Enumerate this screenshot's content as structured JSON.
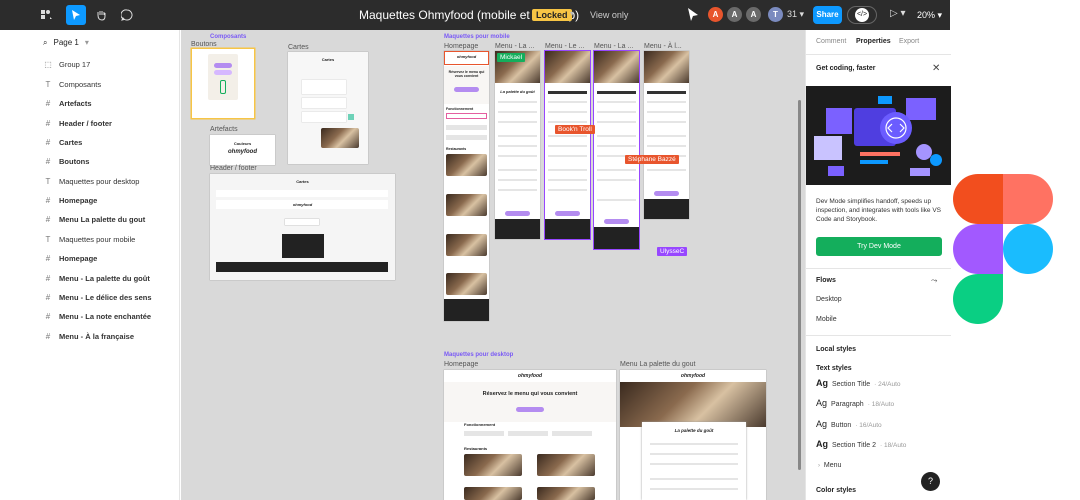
{
  "topbar": {
    "title": "Maquettes Ohmyfood (mobile et desktop)",
    "locked": "Locked",
    "view_only": "View only",
    "avatars": [
      "A",
      "A",
      "A",
      "T"
    ],
    "collaborator_count": "31",
    "share": "Share",
    "zoom": "20%",
    "dev_icon": "</>",
    "icons": [
      "main-menu-icon",
      "move-icon",
      "hand-icon",
      "comment-icon",
      "play-icon"
    ]
  },
  "left": {
    "page": "Page 1",
    "layers": [
      {
        "icon": "⬚",
        "label": "Group 17",
        "bold": false
      },
      {
        "icon": "T",
        "label": "Composants",
        "bold": false
      },
      {
        "icon": "#",
        "label": "Artefacts",
        "bold": true
      },
      {
        "icon": "#",
        "label": "Header / footer",
        "bold": true
      },
      {
        "icon": "#",
        "label": "Cartes",
        "bold": true
      },
      {
        "icon": "#",
        "label": "Boutons",
        "bold": true
      },
      {
        "icon": "T",
        "label": "Maquettes pour desktop",
        "bold": false
      },
      {
        "icon": "#",
        "label": "Homepage",
        "bold": true
      },
      {
        "icon": "#",
        "label": "Menu La palette du gout",
        "bold": true
      },
      {
        "icon": "T",
        "label": "Maquettes pour mobile",
        "bold": false
      },
      {
        "icon": "#",
        "label": "Homepage",
        "bold": true
      },
      {
        "icon": "#",
        "label": "Menu - La palette du goût",
        "bold": true
      },
      {
        "icon": "#",
        "label": "Menu - Le délice des sens",
        "bold": true
      },
      {
        "icon": "#",
        "label": "Menu - La note enchantée",
        "bold": true
      },
      {
        "icon": "#",
        "label": "Menu - À la française",
        "bold": true
      }
    ]
  },
  "canvas": {
    "sections": {
      "composants": "Composants",
      "mobile": "Maquettes pour mobile",
      "desktop": "Maquettes pour desktop"
    },
    "frames": {
      "boutons": "Boutons",
      "cartes": "Cartes",
      "artefacts": "Artefacts",
      "header_footer": "Header / footer",
      "m_home": "Homepage",
      "m_menu1": "Menu - La ...",
      "m_menu2": "Menu - Le ...",
      "m_menu3": "Menu - La ...",
      "m_menu4": "Menu - À l...",
      "d_home": "Homepage",
      "d_menu": "Menu La palette du gout"
    },
    "cursors": [
      {
        "name": "Mickael",
        "color": "#14ae5c"
      },
      {
        "name": "Book'n Troll",
        "color": "#e8552d"
      },
      {
        "name": "Stéphane Bazzé",
        "color": "#e8552d"
      },
      {
        "name": "UlysseC",
        "color": "#9747ff"
      }
    ],
    "mini_text": {
      "logo": "ohmyfood",
      "cartes_title": "Cartes",
      "couleurs": "Couleurs",
      "reserve": "Réservez le menu qui vous convient",
      "fonctionnement": "Fonctionnement",
      "restaurants": "Restaurants",
      "palette": "La palette du goût"
    }
  },
  "right": {
    "tabs": [
      "Comment",
      "Properties",
      "Export"
    ],
    "banner_title": "Get coding, faster",
    "banner_desc": "Dev Mode simplifies handoff, speeds up inspection, and integrates with tools like VS Code and Storybook.",
    "banner_button": "Try Dev Mode",
    "flows_label": "Flows",
    "flows": [
      "Desktop",
      "Mobile"
    ],
    "local_styles": "Local styles",
    "text_styles": "Text styles",
    "styles": [
      {
        "name": "Section Title",
        "meta": "24/Auto"
      },
      {
        "name": "Paragraph",
        "meta": "18/Auto"
      },
      {
        "name": "Button",
        "meta": "16/Auto"
      },
      {
        "name": "Section Title 2",
        "meta": "18/Auto"
      }
    ],
    "menu_group": "Menu",
    "color_styles": "Color styles",
    "help": "?"
  },
  "colors": {
    "figma_blue": "#0d99ff",
    "accent_purple": "#9747ff",
    "dev_green": "#14ae5c",
    "locked_yellow": "#f7c545",
    "toolbar_dark": "#2c2c2c",
    "canvas_gray": "#d9d9d9"
  }
}
